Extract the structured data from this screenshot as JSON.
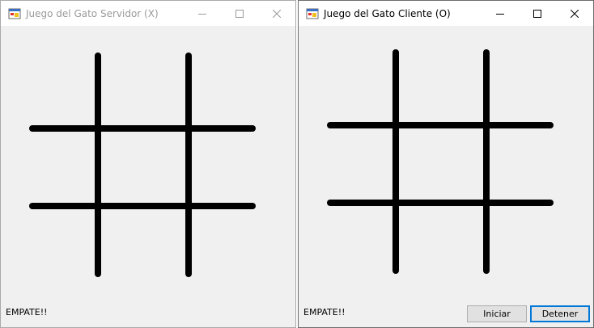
{
  "windows": {
    "server": {
      "title": "Juego del Gato Servidor (X)",
      "status": "EMPATE!!"
    },
    "client": {
      "title": "Juego del Gato Cliente (O)",
      "status": "EMPATE!!",
      "buttons": {
        "start": "Iniciar",
        "stop": "Detener"
      }
    }
  },
  "icons": [
    "app-icon",
    "minimize-icon",
    "maximize-icon",
    "close-icon"
  ],
  "colors": {
    "grid_line": "#000000",
    "window_bg": "#f0f0f0",
    "focus_border": "#0078d7"
  }
}
